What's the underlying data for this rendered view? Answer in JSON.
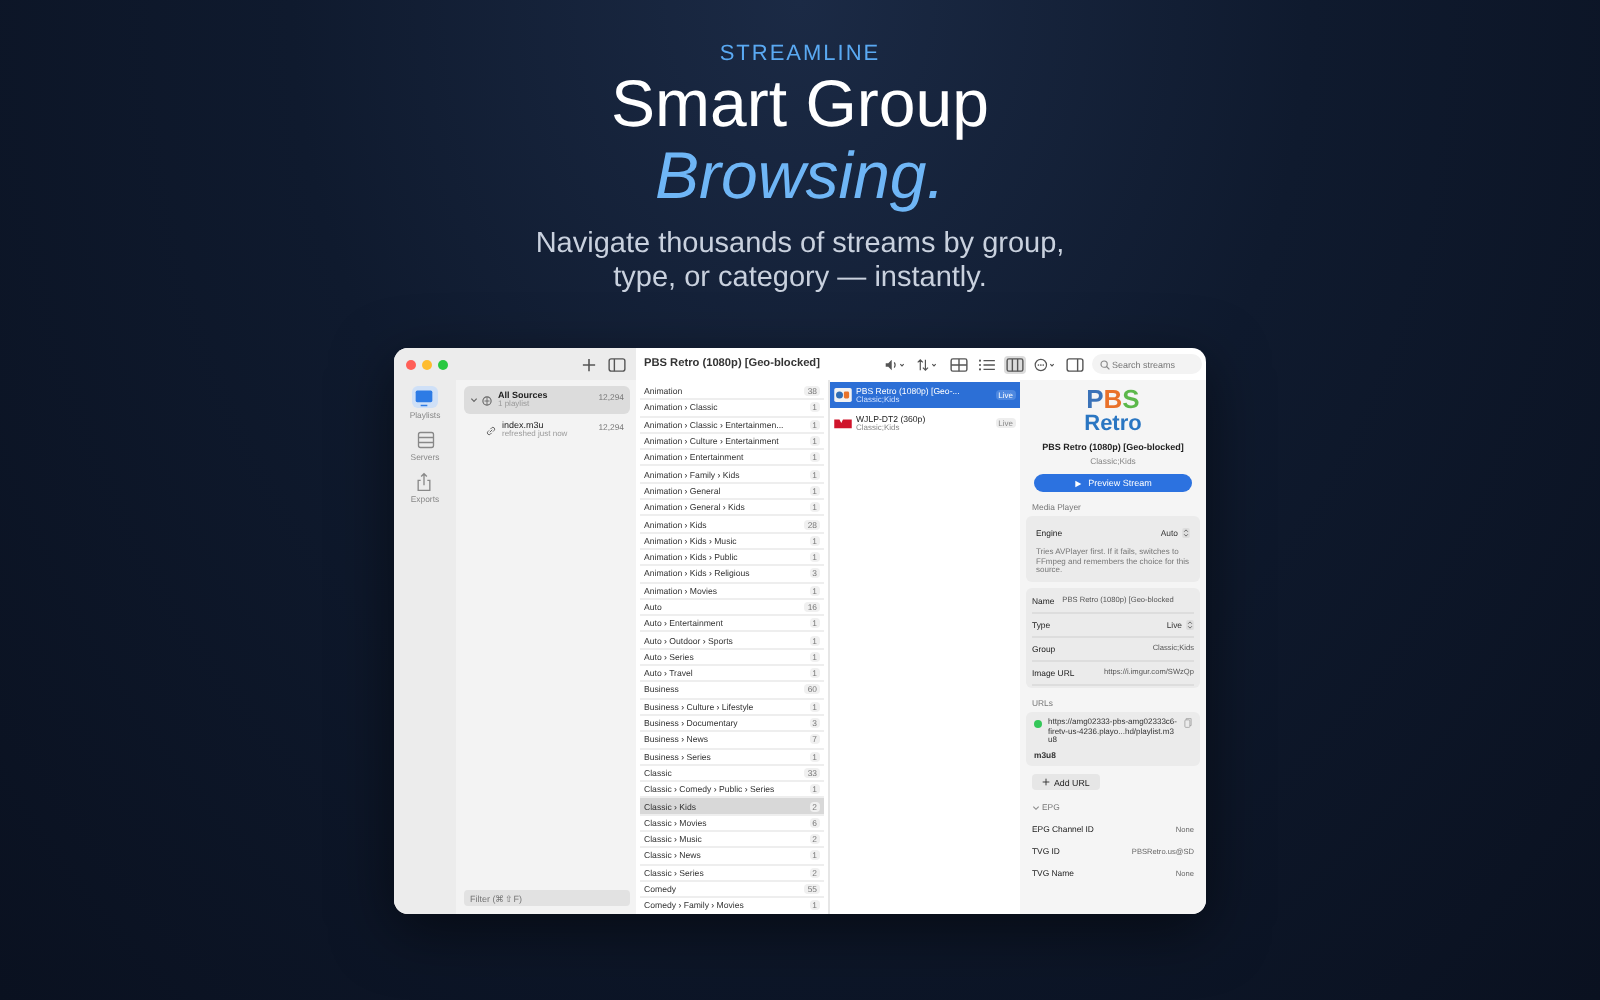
{
  "hero": {
    "eyebrow": "STREAMLINE",
    "title": "Smart Group",
    "title_accent": "Browsing.",
    "subtitle": "Navigate thousands of streams by group, type, or category — instantly."
  },
  "window": {
    "title": "PBS Retro (1080p) [Geo-blocked]"
  },
  "rail": [
    {
      "label": "Playlists",
      "selected": true
    },
    {
      "label": "Servers",
      "selected": false
    },
    {
      "label": "Exports",
      "selected": false
    }
  ],
  "sources": [
    {
      "name": "All Sources",
      "detail": "1 playlist",
      "count": "12,294",
      "selected": true,
      "expanded": true,
      "children": [
        {
          "name": "index.m3u",
          "detail": "refreshed just now",
          "count": "12,294",
          "selected": false
        }
      ]
    }
  ],
  "filter": {
    "placeholder": "Filter (⌘⇧F)"
  },
  "toolbar": {
    "search_placeholder": "Search streams",
    "views": [
      {
        "selected": false
      },
      {
        "selected": false
      },
      {
        "selected": true
      }
    ]
  },
  "groups": [
    {
      "name": "Animation",
      "count": "38",
      "selected": false
    },
    {
      "name": "Animation › Classic",
      "count": "1",
      "selected": false
    },
    {
      "name": "Animation › Classic › Entertainmen...",
      "count": "1",
      "selected": false
    },
    {
      "name": "Animation › Culture › Entertainment",
      "count": "1",
      "selected": false
    },
    {
      "name": "Animation › Entertainment",
      "count": "1",
      "selected": false
    },
    {
      "name": "Animation › Family › Kids",
      "count": "1",
      "selected": false
    },
    {
      "name": "Animation › General",
      "count": "1",
      "selected": false
    },
    {
      "name": "Animation › General › Kids",
      "count": "1",
      "selected": false
    },
    {
      "name": "Animation › Kids",
      "count": "28",
      "selected": false
    },
    {
      "name": "Animation › Kids › Music",
      "count": "1",
      "selected": false
    },
    {
      "name": "Animation › Kids › Public",
      "count": "1",
      "selected": false
    },
    {
      "name": "Animation › Kids › Religious",
      "count": "3",
      "selected": false
    },
    {
      "name": "Animation › Movies",
      "count": "1",
      "selected": false
    },
    {
      "name": "Auto",
      "count": "16",
      "selected": false
    },
    {
      "name": "Auto › Entertainment",
      "count": "1",
      "selected": false
    },
    {
      "name": "Auto › Outdoor › Sports",
      "count": "1",
      "selected": false
    },
    {
      "name": "Auto › Series",
      "count": "1",
      "selected": false
    },
    {
      "name": "Auto › Travel",
      "count": "1",
      "selected": false
    },
    {
      "name": "Business",
      "count": "60",
      "selected": false
    },
    {
      "name": "Business › Culture › Lifestyle",
      "count": "1",
      "selected": false
    },
    {
      "name": "Business › Documentary",
      "count": "3",
      "selected": false
    },
    {
      "name": "Business › News",
      "count": "7",
      "selected": false
    },
    {
      "name": "Business › Series",
      "count": "1",
      "selected": false
    },
    {
      "name": "Classic",
      "count": "33",
      "selected": false
    },
    {
      "name": "Classic › Comedy › Public › Series",
      "count": "1",
      "selected": false
    },
    {
      "name": "Classic › Kids",
      "count": "2",
      "selected": true
    },
    {
      "name": "Classic › Movies",
      "count": "6",
      "selected": false
    },
    {
      "name": "Classic › Music",
      "count": "2",
      "selected": false
    },
    {
      "name": "Classic › News",
      "count": "1",
      "selected": false
    },
    {
      "name": "Classic › Series",
      "count": "2",
      "selected": false
    },
    {
      "name": "Comedy",
      "count": "55",
      "selected": false
    },
    {
      "name": "Comedy › Family › Movies",
      "count": "1",
      "selected": false
    }
  ],
  "streams": [
    {
      "name": "PBS Retro (1080p) [Geo-...",
      "groups": "Classic;Kids",
      "type": "Live",
      "selected": true
    },
    {
      "name": "WJLP-DT2 (360p)",
      "groups": "Classic;Kids",
      "type": "Live",
      "selected": false
    }
  ],
  "detail": {
    "logo_top": "PBS",
    "logo_bottom": "Retro",
    "title": "PBS Retro (1080p) [Geo-blocked]",
    "subtitle": "Classic;Kids",
    "preview_button": "Preview Stream",
    "media_label": "Media Player",
    "engine_label": "Engine",
    "engine_value": "Auto",
    "engine_help": "Tries AVPlayer first. If it fails, switches to FFmpeg and remembers the choice for this source.",
    "fields": [
      {
        "label": "Name",
        "value": "PBS Retro (1080p) [Geo-blocked",
        "kind": "text"
      },
      {
        "label": "Type",
        "value": "Live",
        "kind": "popup"
      },
      {
        "label": "Group",
        "value": "Classic;Kids",
        "kind": "text"
      },
      {
        "label": "Image URL",
        "value": "https://i.imgur.com/SWzQp",
        "kind": "text"
      }
    ],
    "urls_label": "URLs",
    "urls": [
      {
        "url": "https://amg02333-pbs-amg02333c6-firetv-us-4236.playo...hd/playlist.m3u8",
        "format": "m3u8",
        "color": "#34c759"
      }
    ],
    "add_url": "Add URL",
    "epg_label": "EPG",
    "epg_expanded": true,
    "epg": [
      {
        "label": "EPG Channel ID",
        "value": "None"
      },
      {
        "label": "TVG ID",
        "value": "PBSRetro.us@SD"
      },
      {
        "label": "TVG Name",
        "value": "None"
      }
    ]
  }
}
